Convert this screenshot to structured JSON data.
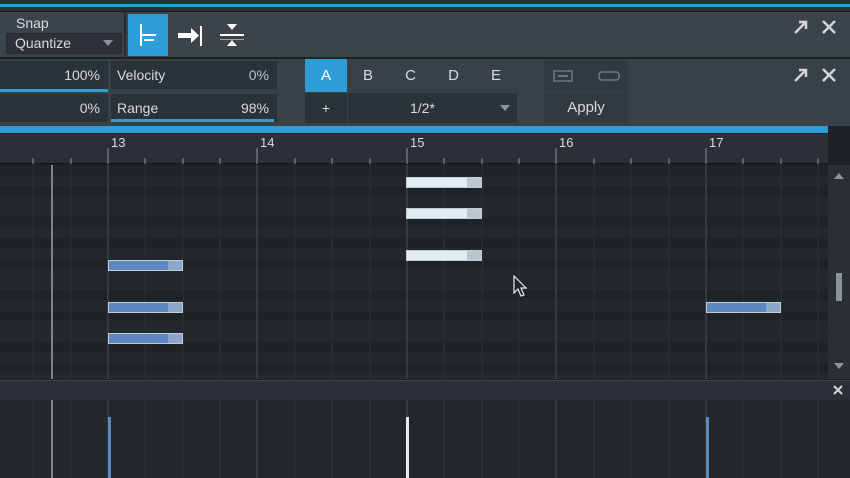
{
  "snap": {
    "label": "Snap",
    "quantize_label": "Quantize"
  },
  "params": {
    "row1_value": "100%",
    "row2_value": "0%",
    "velocity_label": "Velocity",
    "velocity_value": "0%",
    "range_label": "Range",
    "range_value": "98%"
  },
  "groups": {
    "items": [
      "A",
      "B",
      "C",
      "D",
      "E"
    ],
    "active": "A"
  },
  "quantize": {
    "plus": "+",
    "value": "1/2*",
    "apply_label": "Apply"
  },
  "ruler": {
    "bars": [
      "13",
      "14",
      "15",
      "16",
      "17"
    ]
  },
  "icons": [
    "snap-grid-icon",
    "snap-end-icon",
    "snap-split-icon",
    "expand-icon",
    "close-icon",
    "chevron-up-icon",
    "chevron-down-icon"
  ]
}
